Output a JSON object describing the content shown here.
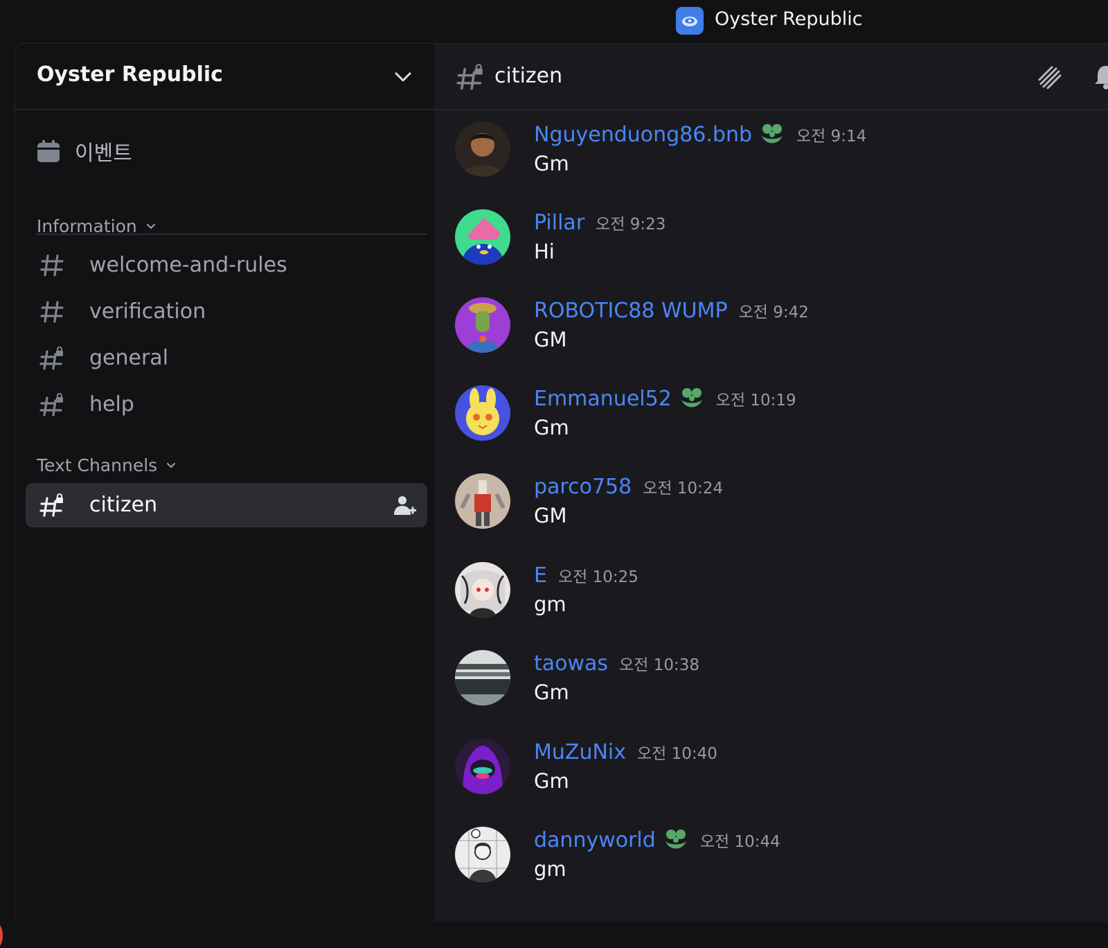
{
  "app": {
    "title": "Oyster Republic"
  },
  "sidebar": {
    "server_name": "Oyster Republic",
    "events_label": "이벤트",
    "categories": [
      {
        "label": "Information",
        "channels": [
          {
            "label": "welcome-and-rules",
            "icon": "hash-icon"
          },
          {
            "label": "verification",
            "icon": "hash-icon"
          },
          {
            "label": "general",
            "icon": "hash-lock-icon"
          },
          {
            "label": "help",
            "icon": "hash-lock-icon"
          }
        ]
      },
      {
        "label": "Text Channels",
        "channels": [
          {
            "label": "citizen",
            "icon": "hash-lock-icon",
            "active": true
          }
        ]
      }
    ]
  },
  "chat": {
    "channel_name": "citizen",
    "messages": [
      {
        "username": "Nguyenduong86.bnb",
        "badge": true,
        "time": "오전 9:14",
        "text": "Gm",
        "avatar_color": "#6b4a2e"
      },
      {
        "username": "Pillar",
        "badge": false,
        "time": "오전 9:23",
        "text": "Hi",
        "avatar_color": "#3fdc8e"
      },
      {
        "username": "ROBOTIC88 WUMP",
        "badge": false,
        "time": "오전 9:42",
        "text": "GM",
        "avatar_color": "#9b3fd6"
      },
      {
        "username": "Emmanuel52",
        "badge": true,
        "time": "오전 10:19",
        "text": "Gm",
        "avatar_color": "#4752e0"
      },
      {
        "username": "parco758",
        "badge": false,
        "time": "오전 10:24",
        "text": "GM",
        "avatar_color": "#c9b8a8"
      },
      {
        "username": "E",
        "badge": false,
        "time": "오전 10:25",
        "text": "gm",
        "avatar_color": "#e8e4e4"
      },
      {
        "username": "taowas",
        "badge": false,
        "time": "오전 10:38",
        "text": "Gm",
        "avatar_color": "#5e6b6a"
      },
      {
        "username": "MuZuNix",
        "badge": false,
        "time": "오전 10:40",
        "text": "Gm",
        "avatar_color": "#7a1fc9"
      },
      {
        "username": "dannyworld",
        "badge": true,
        "time": "오전 10:44",
        "text": "gm",
        "avatar_color": "#e6e6e6"
      }
    ]
  }
}
